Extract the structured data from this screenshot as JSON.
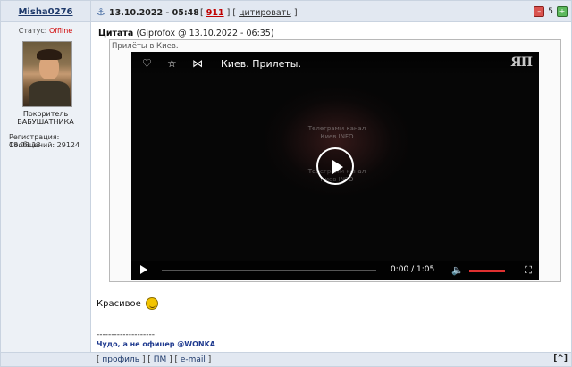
{
  "post": {
    "author": "Misha0276",
    "date": "13.10.2022 - 05:48",
    "post_number": "911",
    "quote_link": "цитировать",
    "reputation": "5"
  },
  "profile": {
    "status_label": "Статус:",
    "status_value": "Offline",
    "rank_line1": "Покоритель",
    "rank_line2": "БАБУШАТНИКА",
    "registration": "Регистрация: 18.08.13",
    "messages": "Сообщений: 29124"
  },
  "quote": {
    "label": "Цитата",
    "source": "(Giprofox @ 13.10.2022 - 06:35)",
    "text": "Прилёты в Киев."
  },
  "video": {
    "title": "Киев. Прилеты.",
    "logo": "ЯП",
    "watermark_line1": "Телеграмм канал",
    "watermark_line2": "Киев INFO",
    "watermark_line3": "Телеграмм канал",
    "watermark_line4": "Киев INFO",
    "current_time": "0:00",
    "duration": "1:05",
    "time_separator": "/"
  },
  "message": {
    "text": "Красивое",
    "signature_separator": "--------------------",
    "signature": "Чудо, а не офицер @WONKA"
  },
  "footer": {
    "profile_link": "профиль",
    "pm_link": "ПМ",
    "email_link": "e-mail",
    "top_link": "^"
  }
}
